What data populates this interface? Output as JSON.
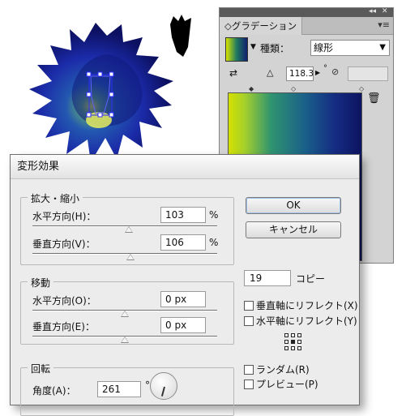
{
  "gradient_panel": {
    "tab_label": "グラデーション",
    "type_label": "種類：",
    "type_value": "線形",
    "angle_value": "118.3",
    "degree_symbol": "°"
  },
  "dialog": {
    "title": "変形効果",
    "scale": {
      "title": "拡大・縮小",
      "horizontal_label": "水平方向(H)：",
      "horizontal_value": "103",
      "vertical_label": "垂直方向(V)：",
      "vertical_value": "106",
      "unit": "%",
      "horizontal_level": 0.52,
      "vertical_level": 0.53
    },
    "move": {
      "title": "移動",
      "horizontal_label": "水平方向(O)：",
      "horizontal_value": "0 px",
      "vertical_label": "垂直方向(E)：",
      "vertical_value": "0 px",
      "horizontal_level": 0.5,
      "vertical_level": 0.5
    },
    "rotate": {
      "title": "回転",
      "angle_label": "角度(A)：",
      "angle_value": "261",
      "degree_symbol": "°"
    },
    "ok_label": "OK",
    "cancel_label": "キャンセル",
    "copies_value": "19",
    "copies_label": "コピー",
    "reflect_vertical_label": "垂直軸にリフレクト(X)",
    "reflect_horizontal_label": "水平軸にリフレクト(Y)",
    "random_label": "ランダム(R)",
    "preview_label": "プレビュー(P)"
  },
  "colors": {
    "gradient_start": "#d4e000",
    "gradient_end": "#0d1460",
    "flower_blue": "#1c2fb0"
  },
  "icons": [
    "reverse-gradient-icon",
    "angle-icon",
    "aspect-ratio-icon",
    "trash-icon",
    "reference-point-icon",
    "angle-dial-icon",
    "panel-menu-icon"
  ]
}
